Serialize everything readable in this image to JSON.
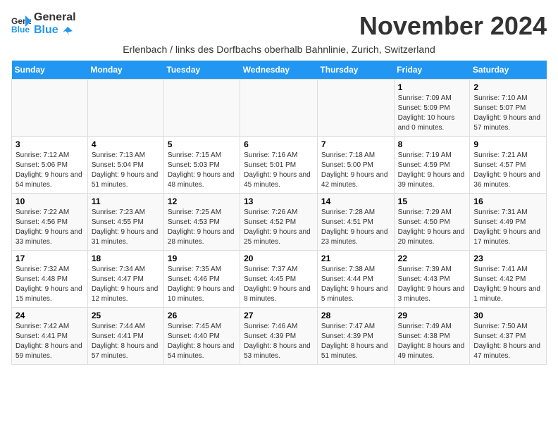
{
  "logo": {
    "general": "General",
    "blue": "Blue"
  },
  "title": "November 2024",
  "subtitle": "Erlenbach / links des Dorfbachs oberhalb Bahnlinie, Zurich, Switzerland",
  "days_of_week": [
    "Sunday",
    "Monday",
    "Tuesday",
    "Wednesday",
    "Thursday",
    "Friday",
    "Saturday"
  ],
  "weeks": [
    [
      {
        "day": "",
        "info": ""
      },
      {
        "day": "",
        "info": ""
      },
      {
        "day": "",
        "info": ""
      },
      {
        "day": "",
        "info": ""
      },
      {
        "day": "",
        "info": ""
      },
      {
        "day": "1",
        "info": "Sunrise: 7:09 AM\nSunset: 5:09 PM\nDaylight: 10 hours and 0 minutes."
      },
      {
        "day": "2",
        "info": "Sunrise: 7:10 AM\nSunset: 5:07 PM\nDaylight: 9 hours and 57 minutes."
      }
    ],
    [
      {
        "day": "3",
        "info": "Sunrise: 7:12 AM\nSunset: 5:06 PM\nDaylight: 9 hours and 54 minutes."
      },
      {
        "day": "4",
        "info": "Sunrise: 7:13 AM\nSunset: 5:04 PM\nDaylight: 9 hours and 51 minutes."
      },
      {
        "day": "5",
        "info": "Sunrise: 7:15 AM\nSunset: 5:03 PM\nDaylight: 9 hours and 48 minutes."
      },
      {
        "day": "6",
        "info": "Sunrise: 7:16 AM\nSunset: 5:01 PM\nDaylight: 9 hours and 45 minutes."
      },
      {
        "day": "7",
        "info": "Sunrise: 7:18 AM\nSunset: 5:00 PM\nDaylight: 9 hours and 42 minutes."
      },
      {
        "day": "8",
        "info": "Sunrise: 7:19 AM\nSunset: 4:59 PM\nDaylight: 9 hours and 39 minutes."
      },
      {
        "day": "9",
        "info": "Sunrise: 7:21 AM\nSunset: 4:57 PM\nDaylight: 9 hours and 36 minutes."
      }
    ],
    [
      {
        "day": "10",
        "info": "Sunrise: 7:22 AM\nSunset: 4:56 PM\nDaylight: 9 hours and 33 minutes."
      },
      {
        "day": "11",
        "info": "Sunrise: 7:23 AM\nSunset: 4:55 PM\nDaylight: 9 hours and 31 minutes."
      },
      {
        "day": "12",
        "info": "Sunrise: 7:25 AM\nSunset: 4:53 PM\nDaylight: 9 hours and 28 minutes."
      },
      {
        "day": "13",
        "info": "Sunrise: 7:26 AM\nSunset: 4:52 PM\nDaylight: 9 hours and 25 minutes."
      },
      {
        "day": "14",
        "info": "Sunrise: 7:28 AM\nSunset: 4:51 PM\nDaylight: 9 hours and 23 minutes."
      },
      {
        "day": "15",
        "info": "Sunrise: 7:29 AM\nSunset: 4:50 PM\nDaylight: 9 hours and 20 minutes."
      },
      {
        "day": "16",
        "info": "Sunrise: 7:31 AM\nSunset: 4:49 PM\nDaylight: 9 hours and 17 minutes."
      }
    ],
    [
      {
        "day": "17",
        "info": "Sunrise: 7:32 AM\nSunset: 4:48 PM\nDaylight: 9 hours and 15 minutes."
      },
      {
        "day": "18",
        "info": "Sunrise: 7:34 AM\nSunset: 4:47 PM\nDaylight: 9 hours and 12 minutes."
      },
      {
        "day": "19",
        "info": "Sunrise: 7:35 AM\nSunset: 4:46 PM\nDaylight: 9 hours and 10 minutes."
      },
      {
        "day": "20",
        "info": "Sunrise: 7:37 AM\nSunset: 4:45 PM\nDaylight: 9 hours and 8 minutes."
      },
      {
        "day": "21",
        "info": "Sunrise: 7:38 AM\nSunset: 4:44 PM\nDaylight: 9 hours and 5 minutes."
      },
      {
        "day": "22",
        "info": "Sunrise: 7:39 AM\nSunset: 4:43 PM\nDaylight: 9 hours and 3 minutes."
      },
      {
        "day": "23",
        "info": "Sunrise: 7:41 AM\nSunset: 4:42 PM\nDaylight: 9 hours and 1 minute."
      }
    ],
    [
      {
        "day": "24",
        "info": "Sunrise: 7:42 AM\nSunset: 4:41 PM\nDaylight: 8 hours and 59 minutes."
      },
      {
        "day": "25",
        "info": "Sunrise: 7:44 AM\nSunset: 4:41 PM\nDaylight: 8 hours and 57 minutes."
      },
      {
        "day": "26",
        "info": "Sunrise: 7:45 AM\nSunset: 4:40 PM\nDaylight: 8 hours and 54 minutes."
      },
      {
        "day": "27",
        "info": "Sunrise: 7:46 AM\nSunset: 4:39 PM\nDaylight: 8 hours and 53 minutes."
      },
      {
        "day": "28",
        "info": "Sunrise: 7:47 AM\nSunset: 4:39 PM\nDaylight: 8 hours and 51 minutes."
      },
      {
        "day": "29",
        "info": "Sunrise: 7:49 AM\nSunset: 4:38 PM\nDaylight: 8 hours and 49 minutes."
      },
      {
        "day": "30",
        "info": "Sunrise: 7:50 AM\nSunset: 4:37 PM\nDaylight: 8 hours and 47 minutes."
      }
    ]
  ]
}
